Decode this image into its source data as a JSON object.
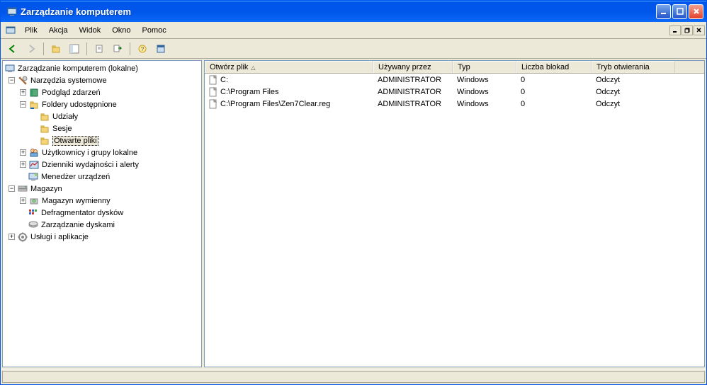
{
  "window": {
    "title": "Zarządzanie komputerem"
  },
  "menu": {
    "items": [
      "Plik",
      "Akcja",
      "Widok",
      "Okno",
      "Pomoc"
    ]
  },
  "tree": {
    "root": "Zarządzanie komputerem (lokalne)",
    "sys_tools": "Narzędzia systemowe",
    "event_viewer": "Podgląd zdarzeń",
    "shared_folders": "Foldery udostępnione",
    "shares": "Udziały",
    "sessions": "Sesje",
    "open_files": "Otwarte pliki",
    "users_groups": "Użytkownicy i grupy lokalne",
    "perf_logs": "Dzienniki wydajności i alerty",
    "device_mgr": "Menedżer urządzeń",
    "storage": "Magazyn",
    "removable": "Magazyn wymienny",
    "defrag": "Defragmentator dysków",
    "disk_mgmt": "Zarządzanie dyskami",
    "services_apps": "Usługi i aplikacje"
  },
  "columns": {
    "c0": "Otwórz plik",
    "c1": "Używany przez",
    "c2": "Typ",
    "c3": "Liczba blokad",
    "c4": "Tryb otwierania"
  },
  "column_widths": {
    "c0": 238,
    "c1": 112,
    "c2": 90,
    "c3": 106,
    "c4": 118
  },
  "rows": [
    {
      "file": "C:",
      "user": "ADMINISTRATOR",
      "type": "Windows",
      "locks": "0",
      "mode": "Odczyt"
    },
    {
      "file": "C:\\Program Files",
      "user": "ADMINISTRATOR",
      "type": "Windows",
      "locks": "0",
      "mode": "Odczyt"
    },
    {
      "file": "C:\\Program Files\\Zen7Clear.reg",
      "user": "ADMINISTRATOR",
      "type": "Windows",
      "locks": "0",
      "mode": "Odczyt"
    }
  ]
}
